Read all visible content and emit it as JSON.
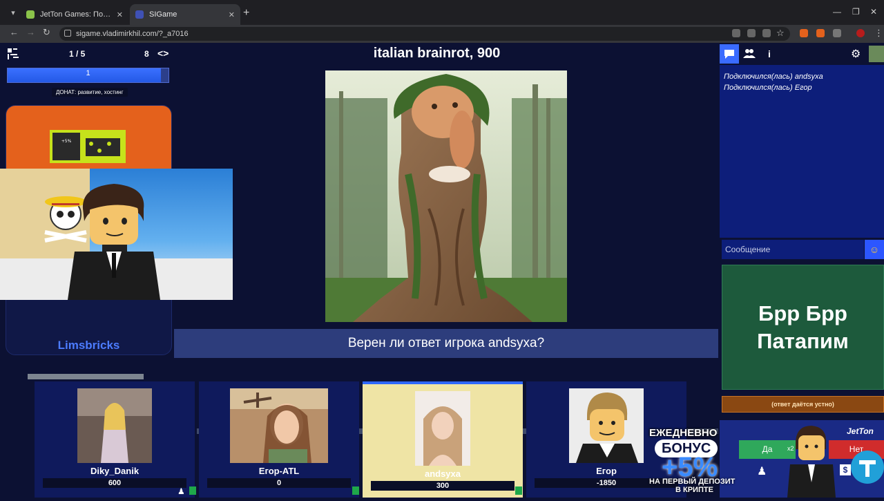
{
  "browser": {
    "tabs": [
      {
        "title": "JetTon Games: Погружение в мир",
        "active": false,
        "favicon_color": "#8bc34a"
      },
      {
        "title": "SIGame",
        "active": true,
        "favicon_color": "#3f51b5"
      }
    ],
    "url": "sigame.vladimirkhil.com/?_a7016"
  },
  "header": {
    "round_progress": "1 / 5",
    "round_total": "8",
    "title": "italian brainrot, 900"
  },
  "left": {
    "progress_value": "1",
    "donate": "ДОНАТ: развитие, хостинг",
    "host_name": "Limsbricks"
  },
  "center": {
    "question": "Верен ли ответ игрока andsyxa?"
  },
  "players": [
    {
      "name": "Diky_Danik",
      "score": "600",
      "selected": false
    },
    {
      "name": "Егор-ATL",
      "score": "0",
      "selected": false
    },
    {
      "name": "andsyxa",
      "score": "300",
      "selected": true
    },
    {
      "name": "Егор",
      "score": "-1850",
      "selected": false
    }
  ],
  "right": {
    "chat_log": [
      "Подключился(лась) andsyxa",
      "Подключился(лась) Егор"
    ],
    "message_placeholder": "Сообщение",
    "answer": "Брр Брр Патапим",
    "oral_note": "(ответ даётся устно)",
    "yes_label": "Да",
    "no_label": "Нет",
    "x2_label": "x2"
  },
  "ad": {
    "line1": "ЕЖЕДНЕВНО",
    "line2": "БОНУС",
    "line3": "+5%",
    "line4": "НА ПЕРВЫЙ ДЕПОЗИТ",
    "line5": "В КРИПТЕ",
    "brand": "JetTon"
  },
  "colors": {
    "background": "#0c1133",
    "accent": "#3a6bff",
    "answer_card": "#1d5a3c",
    "yes": "#2fa85b",
    "no": "#d02c2c"
  }
}
